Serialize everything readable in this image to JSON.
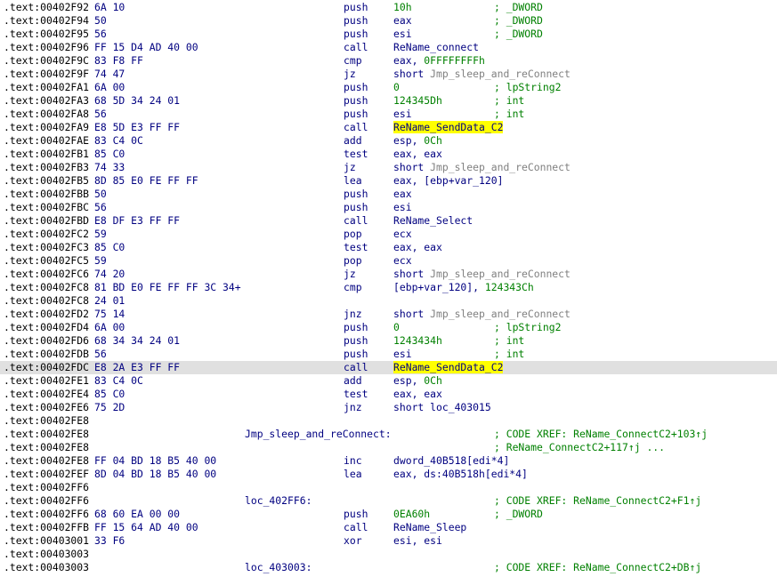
{
  "colors": {
    "background": "#ffffff",
    "address": "#000000",
    "code": "#000080",
    "number": "#008000",
    "comment": "#008000",
    "reference": "#808080",
    "highlight": "#ffff00",
    "selected_row": "#e0e0e0"
  },
  "rows": [
    {
      "addr": ".text:00402F92",
      "bytes": "6A 10",
      "label": "",
      "mnem": "push",
      "ops": [
        {
          "t": "10h",
          "c": "num"
        }
      ],
      "comment": "; _DWORD"
    },
    {
      "addr": ".text:00402F94",
      "bytes": "50",
      "label": "",
      "mnem": "push",
      "ops": [
        {
          "t": "eax",
          "c": "default"
        }
      ],
      "comment": "; _DWORD"
    },
    {
      "addr": ".text:00402F95",
      "bytes": "56",
      "label": "",
      "mnem": "push",
      "ops": [
        {
          "t": "esi",
          "c": "default"
        }
      ],
      "comment": "; _DWORD"
    },
    {
      "addr": ".text:00402F96",
      "bytes": "FF 15 D4 AD 40 00",
      "label": "",
      "mnem": "call",
      "ops": [
        {
          "t": "ReName_connect",
          "c": "default"
        }
      ],
      "comment": ""
    },
    {
      "addr": ".text:00402F9C",
      "bytes": "83 F8 FF",
      "label": "",
      "mnem": "cmp",
      "ops": [
        {
          "t": "eax, ",
          "c": "default"
        },
        {
          "t": "0FFFFFFFFh",
          "c": "num"
        }
      ],
      "comment": ""
    },
    {
      "addr": ".text:00402F9F",
      "bytes": "74 47",
      "label": "",
      "mnem": "jz",
      "ops": [
        {
          "t": "short ",
          "c": "default"
        },
        {
          "t": "Jmp_sleep_and_reConnect",
          "c": "ref"
        }
      ],
      "comment": ""
    },
    {
      "addr": ".text:00402FA1",
      "bytes": "6A 00",
      "label": "",
      "mnem": "push",
      "ops": [
        {
          "t": "0",
          "c": "num"
        }
      ],
      "comment": "; lpString2"
    },
    {
      "addr": ".text:00402FA3",
      "bytes": "68 5D 34 24 01",
      "label": "",
      "mnem": "push",
      "ops": [
        {
          "t": "124345Dh",
          "c": "num"
        }
      ],
      "comment": "; int"
    },
    {
      "addr": ".text:00402FA8",
      "bytes": "56",
      "label": "",
      "mnem": "push",
      "ops": [
        {
          "t": "esi",
          "c": "default"
        }
      ],
      "comment": "; int"
    },
    {
      "addr": ".text:00402FA9",
      "bytes": "E8 5D E3 FF FF",
      "label": "",
      "mnem": "call",
      "ops": [
        {
          "t": "ReName_SendData_C2",
          "c": "hl"
        }
      ],
      "comment": ""
    },
    {
      "addr": ".text:00402FAE",
      "bytes": "83 C4 0C",
      "label": "",
      "mnem": "add",
      "ops": [
        {
          "t": "esp, ",
          "c": "default"
        },
        {
          "t": "0Ch",
          "c": "num"
        }
      ],
      "comment": ""
    },
    {
      "addr": ".text:00402FB1",
      "bytes": "85 C0",
      "label": "",
      "mnem": "test",
      "ops": [
        {
          "t": "eax, eax",
          "c": "default"
        }
      ],
      "comment": ""
    },
    {
      "addr": ".text:00402FB3",
      "bytes": "74 33",
      "label": "",
      "mnem": "jz",
      "ops": [
        {
          "t": "short ",
          "c": "default"
        },
        {
          "t": "Jmp_sleep_and_reConnect",
          "c": "ref"
        }
      ],
      "comment": ""
    },
    {
      "addr": ".text:00402FB5",
      "bytes": "8D 85 E0 FE FF FF",
      "label": "",
      "mnem": "lea",
      "ops": [
        {
          "t": "eax, [ebp+var_120]",
          "c": "default"
        }
      ],
      "comment": ""
    },
    {
      "addr": ".text:00402FBB",
      "bytes": "50",
      "label": "",
      "mnem": "push",
      "ops": [
        {
          "t": "eax",
          "c": "default"
        }
      ],
      "comment": ""
    },
    {
      "addr": ".text:00402FBC",
      "bytes": "56",
      "label": "",
      "mnem": "push",
      "ops": [
        {
          "t": "esi",
          "c": "default"
        }
      ],
      "comment": ""
    },
    {
      "addr": ".text:00402FBD",
      "bytes": "E8 DF E3 FF FF",
      "label": "",
      "mnem": "call",
      "ops": [
        {
          "t": "ReName_Select",
          "c": "default"
        }
      ],
      "comment": ""
    },
    {
      "addr": ".text:00402FC2",
      "bytes": "59",
      "label": "",
      "mnem": "pop",
      "ops": [
        {
          "t": "ecx",
          "c": "default"
        }
      ],
      "comment": ""
    },
    {
      "addr": ".text:00402FC3",
      "bytes": "85 C0",
      "label": "",
      "mnem": "test",
      "ops": [
        {
          "t": "eax, eax",
          "c": "default"
        }
      ],
      "comment": ""
    },
    {
      "addr": ".text:00402FC5",
      "bytes": "59",
      "label": "",
      "mnem": "pop",
      "ops": [
        {
          "t": "ecx",
          "c": "default"
        }
      ],
      "comment": ""
    },
    {
      "addr": ".text:00402FC6",
      "bytes": "74 20",
      "label": "",
      "mnem": "jz",
      "ops": [
        {
          "t": "short ",
          "c": "default"
        },
        {
          "t": "Jmp_sleep_and_reConnect",
          "c": "ref"
        }
      ],
      "comment": ""
    },
    {
      "addr": ".text:00402FC8",
      "bytes": "81 BD E0 FE FF FF 3C 34+",
      "label": "",
      "mnem": "cmp",
      "ops": [
        {
          "t": "[ebp+var_120], ",
          "c": "default"
        },
        {
          "t": "124343Ch",
          "c": "num"
        }
      ],
      "comment": ""
    },
    {
      "addr": ".text:00402FC8",
      "bytes": "24 01",
      "label": "",
      "mnem": "",
      "ops": [],
      "comment": ""
    },
    {
      "addr": ".text:00402FD2",
      "bytes": "75 14",
      "label": "",
      "mnem": "jnz",
      "ops": [
        {
          "t": "short ",
          "c": "default"
        },
        {
          "t": "Jmp_sleep_and_reConnect",
          "c": "ref"
        }
      ],
      "comment": ""
    },
    {
      "addr": ".text:00402FD4",
      "bytes": "6A 00",
      "label": "",
      "mnem": "push",
      "ops": [
        {
          "t": "0",
          "c": "num"
        }
      ],
      "comment": "; lpString2"
    },
    {
      "addr": ".text:00402FD6",
      "bytes": "68 34 34 24 01",
      "label": "",
      "mnem": "push",
      "ops": [
        {
          "t": "1243434h",
          "c": "num"
        }
      ],
      "comment": "; int"
    },
    {
      "addr": ".text:00402FDB",
      "bytes": "56",
      "label": "",
      "mnem": "push",
      "ops": [
        {
          "t": "esi",
          "c": "default"
        }
      ],
      "comment": "; int"
    },
    {
      "addr": ".text:00402FDC",
      "bytes": "E8 2A E3 FF FF",
      "label": "",
      "mnem": "call",
      "ops": [
        {
          "t": "ReName_SendData_C2",
          "c": "hl"
        }
      ],
      "comment": "",
      "selected": true
    },
    {
      "addr": ".text:00402FE1",
      "bytes": "83 C4 0C",
      "label": "",
      "mnem": "add",
      "ops": [
        {
          "t": "esp, ",
          "c": "default"
        },
        {
          "t": "0Ch",
          "c": "num"
        }
      ],
      "comment": ""
    },
    {
      "addr": ".text:00402FE4",
      "bytes": "85 C0",
      "label": "",
      "mnem": "test",
      "ops": [
        {
          "t": "eax, eax",
          "c": "default"
        }
      ],
      "comment": ""
    },
    {
      "addr": ".text:00402FE6",
      "bytes": "75 2D",
      "label": "",
      "mnem": "jnz",
      "ops": [
        {
          "t": "short loc_403015",
          "c": "default"
        }
      ],
      "comment": ""
    },
    {
      "addr": ".text:00402FE8",
      "bytes": "",
      "label": "",
      "mnem": "",
      "ops": [],
      "comment": ""
    },
    {
      "addr": ".text:00402FE8",
      "bytes": "",
      "label": "Jmp_sleep_and_reConnect:",
      "mnem": "",
      "ops": [],
      "comment": "; CODE XREF: ReName_ConnectC2+103↑j"
    },
    {
      "addr": ".text:00402FE8",
      "bytes": "",
      "label": "",
      "mnem": "",
      "ops": [],
      "comment": "; ReName_ConnectC2+117↑j ..."
    },
    {
      "addr": ".text:00402FE8",
      "bytes": "FF 04 BD 18 B5 40 00",
      "label": "",
      "mnem": "inc",
      "ops": [
        {
          "t": "dword_40B518[edi*4]",
          "c": "default"
        }
      ],
      "comment": ""
    },
    {
      "addr": ".text:00402FEF",
      "bytes": "8D 04 BD 18 B5 40 00",
      "label": "",
      "mnem": "lea",
      "ops": [
        {
          "t": "eax, ds:40B518h[edi*4]",
          "c": "default"
        }
      ],
      "comment": ""
    },
    {
      "addr": ".text:00402FF6",
      "bytes": "",
      "label": "",
      "mnem": "",
      "ops": [],
      "comment": ""
    },
    {
      "addr": ".text:00402FF6",
      "bytes": "",
      "label": "loc_402FF6:",
      "mnem": "",
      "ops": [],
      "comment": "; CODE XREF: ReName_ConnectC2+F1↑j"
    },
    {
      "addr": ".text:00402FF6",
      "bytes": "68 60 EA 00 00",
      "label": "",
      "mnem": "push",
      "ops": [
        {
          "t": "0EA60h",
          "c": "num"
        }
      ],
      "comment": "; _DWORD"
    },
    {
      "addr": ".text:00402FFB",
      "bytes": "FF 15 64 AD 40 00",
      "label": "",
      "mnem": "call",
      "ops": [
        {
          "t": "ReName_Sleep",
          "c": "default"
        }
      ],
      "comment": ""
    },
    {
      "addr": ".text:00403001",
      "bytes": "33 F6",
      "label": "",
      "mnem": "xor",
      "ops": [
        {
          "t": "esi, esi",
          "c": "default"
        }
      ],
      "comment": ""
    },
    {
      "addr": ".text:00403003",
      "bytes": "",
      "label": "",
      "mnem": "",
      "ops": [],
      "comment": ""
    },
    {
      "addr": ".text:00403003",
      "bytes": "",
      "label": "loc_403003:",
      "mnem": "",
      "ops": [],
      "comment": "; CODE XREF: ReName_ConnectC2+DB↑j"
    }
  ]
}
